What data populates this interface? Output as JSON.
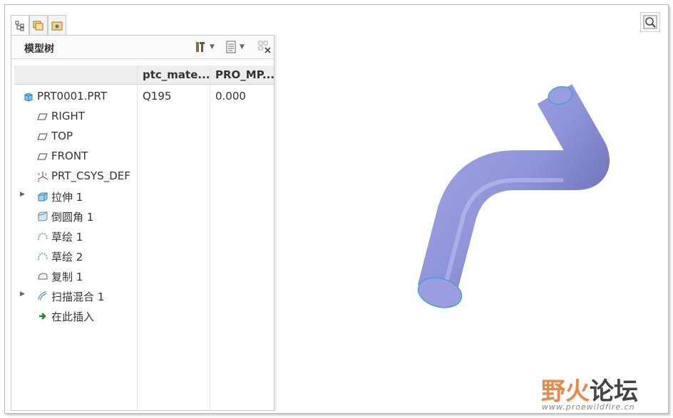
{
  "panel": {
    "title": "模型树"
  },
  "tree": {
    "columns": [
      "ptc_mate...",
      "PRO_MP..."
    ],
    "rows": [
      {
        "label": "PRT0001.PRT",
        "icon": "part-icon",
        "expander": false,
        "material": "Q195",
        "mp": "0.000"
      },
      {
        "label": "RIGHT",
        "icon": "datum-plane-icon",
        "expander": false,
        "material": "",
        "mp": ""
      },
      {
        "label": "TOP",
        "icon": "datum-plane-icon",
        "expander": false,
        "material": "",
        "mp": ""
      },
      {
        "label": "FRONT",
        "icon": "datum-plane-icon",
        "expander": false,
        "material": "",
        "mp": ""
      },
      {
        "label": "PRT_CSYS_DEF",
        "icon": "csys-icon",
        "expander": false,
        "material": "",
        "mp": ""
      },
      {
        "label": "拉伸 1",
        "icon": "extrude-icon",
        "expander": true,
        "material": "",
        "mp": ""
      },
      {
        "label": "倒圆角 1",
        "icon": "round-icon",
        "expander": false,
        "material": "",
        "mp": ""
      },
      {
        "label": "草绘 1",
        "icon": "sketch-icon",
        "expander": false,
        "material": "",
        "mp": ""
      },
      {
        "label": "草绘 2",
        "icon": "sketch-icon",
        "expander": false,
        "material": "",
        "mp": ""
      },
      {
        "label": "复制 1",
        "icon": "copy-surface-icon",
        "expander": false,
        "material": "",
        "mp": ""
      },
      {
        "label": "扫描混合 1",
        "icon": "swept-blend-icon",
        "expander": true,
        "material": "",
        "mp": ""
      },
      {
        "label": "在此插入",
        "icon": "insert-here-icon",
        "expander": false,
        "material": "",
        "mp": ""
      }
    ]
  },
  "watermark": {
    "logo_part1": "野火",
    "logo_part2": "论坛",
    "url": "www.proewildfire.cn"
  },
  "colors": {
    "model_fill": "#8f93d8",
    "model_edge": "#4aa3d8",
    "watermark_accent": "#e8894a"
  }
}
